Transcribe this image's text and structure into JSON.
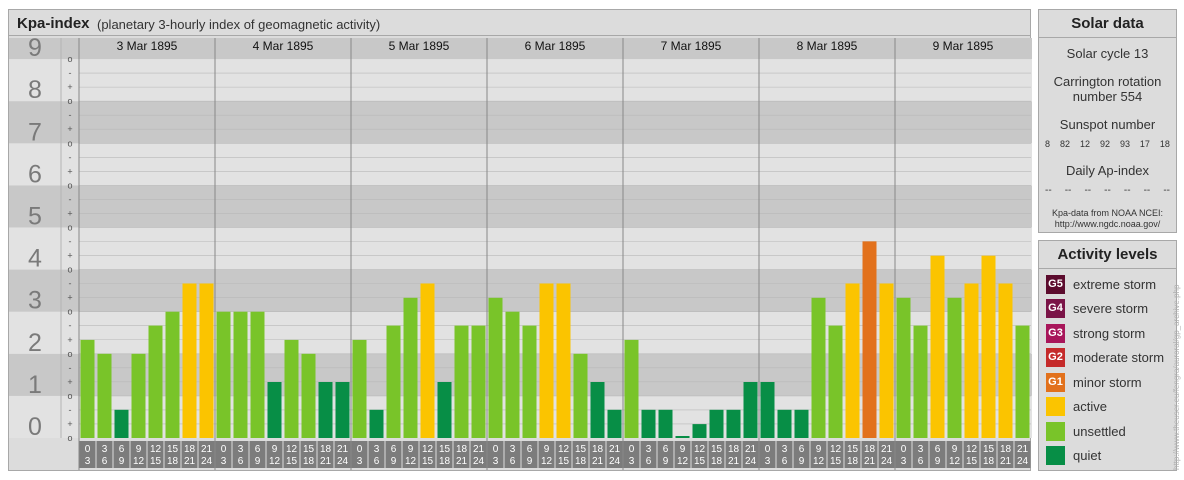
{
  "header": {
    "title": "Kpa-index",
    "subtitle": "(planetary 3-hourly index of geomagnetic activity)"
  },
  "chart_data": {
    "type": "bar",
    "title": "Kpa-index",
    "subtitle": "(planetary 3-hourly index of geomagnetic activity)",
    "ylim": [
      0,
      9
    ],
    "yticks": [
      "0",
      "1",
      "2",
      "3",
      "4",
      "5",
      "6",
      "7",
      "8",
      "9"
    ],
    "minor_ticks": [
      "o",
      "+",
      "-"
    ],
    "days": [
      "3 Mar 1895",
      "4 Mar 1895",
      "5 Mar 1895",
      "6 Mar 1895",
      "7 Mar 1895",
      "8 Mar 1895",
      "9 Mar 1895"
    ],
    "interval_start": [
      "0",
      "3",
      "6",
      "9",
      "12",
      "15",
      "18",
      "21"
    ],
    "interval_end": [
      "3",
      "6",
      "9",
      "12",
      "15",
      "18",
      "21",
      "24"
    ],
    "values": [
      2.33,
      2.0,
      0.67,
      2.0,
      2.67,
      3.0,
      3.67,
      3.67,
      3.0,
      3.0,
      3.0,
      1.33,
      2.33,
      2.0,
      1.33,
      1.33,
      2.33,
      0.67,
      2.67,
      3.33,
      3.67,
      1.33,
      2.67,
      2.67,
      3.33,
      3.0,
      2.67,
      3.67,
      3.67,
      2.0,
      1.33,
      0.67,
      2.33,
      0.67,
      0.67,
      0.0,
      0.33,
      0.67,
      0.67,
      1.33,
      1.33,
      0.67,
      0.67,
      3.33,
      2.67,
      3.67,
      4.67,
      3.67,
      3.33,
      2.67,
      4.33,
      3.33,
      3.67,
      4.33,
      3.67,
      2.67
    ],
    "colors": {
      "quiet": "#078e46",
      "unsettled": "#79c429",
      "active": "#fbc400",
      "minor_storm": "#e2711c",
      "plot_background_light": "#e2e2e2",
      "plot_background_dark": "#c8c8c8",
      "tick_box": "#7c7c7c"
    }
  },
  "solar": {
    "title": "Solar data",
    "cycle": "Solar cycle 13",
    "carrington": "Carrington rotation number 554",
    "sunspot_label": "Sunspot number",
    "sunspot_values": [
      "8",
      "82",
      "12",
      "92",
      "93",
      "17",
      "18"
    ],
    "ap_label": "Daily Ap-index",
    "ap_values": [
      "--",
      "--",
      "--",
      "--",
      "--",
      "--",
      "--"
    ],
    "source_line1": "Kpa-data from NOAA NCEI:",
    "source_line2": "http://www.ngdc.noaa.gov/"
  },
  "levels": {
    "title": "Activity levels",
    "items": [
      {
        "code": "G5",
        "label": "extreme storm",
        "color": "#5c0c2e"
      },
      {
        "code": "G4",
        "label": "severe storm",
        "color": "#7a1447"
      },
      {
        "code": "G3",
        "label": "strong storm",
        "color": "#a8165a"
      },
      {
        "code": "G2",
        "label": "moderate storm",
        "color": "#c52a2a"
      },
      {
        "code": "G1",
        "label": "minor storm",
        "color": "#e2711c"
      },
      {
        "code": "",
        "label": "active",
        "color": "#fbc400"
      },
      {
        "code": "",
        "label": "unsettled",
        "color": "#79c429"
      },
      {
        "code": "",
        "label": "quiet",
        "color": "#078e46"
      }
    ]
  },
  "watermark": "http://www.theuser.eu/fengra/auroral/gp_archive.php"
}
